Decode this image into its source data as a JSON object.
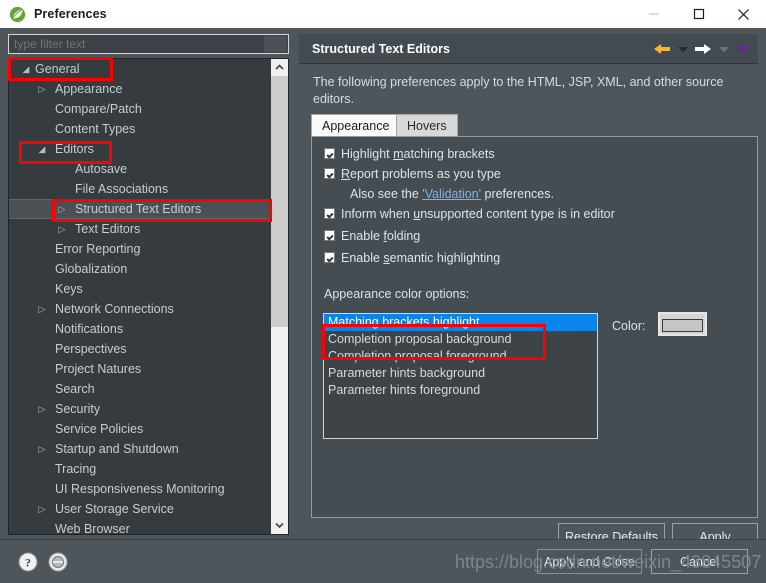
{
  "window": {
    "title": "Preferences",
    "icon": "spring-leaf-icon",
    "controls": {
      "minimize": "–",
      "maximize": "□",
      "close": "✕"
    }
  },
  "sidebar": {
    "filter": {
      "placeholder": "type filter text",
      "value": ""
    },
    "items": [
      {
        "label": "General",
        "indent": 0,
        "twisty": "expanded",
        "selected": false
      },
      {
        "label": "Appearance",
        "indent": 1,
        "twisty": "collapsed",
        "selected": false
      },
      {
        "label": "Compare/Patch",
        "indent": 1,
        "twisty": "none",
        "selected": false
      },
      {
        "label": "Content Types",
        "indent": 1,
        "twisty": "none",
        "selected": false
      },
      {
        "label": "Editors",
        "indent": 1,
        "twisty": "expanded",
        "selected": false
      },
      {
        "label": "Autosave",
        "indent": 2,
        "twisty": "none",
        "selected": false
      },
      {
        "label": "File Associations",
        "indent": 2,
        "twisty": "none",
        "selected": false
      },
      {
        "label": "Structured Text Editors",
        "indent": 2,
        "twisty": "collapsed",
        "selected": true
      },
      {
        "label": "Text Editors",
        "indent": 2,
        "twisty": "collapsed",
        "selected": false
      },
      {
        "label": "Error Reporting",
        "indent": 1,
        "twisty": "none",
        "selected": false
      },
      {
        "label": "Globalization",
        "indent": 1,
        "twisty": "none",
        "selected": false
      },
      {
        "label": "Keys",
        "indent": 1,
        "twisty": "none",
        "selected": false
      },
      {
        "label": "Network Connections",
        "indent": 1,
        "twisty": "collapsed",
        "selected": false
      },
      {
        "label": "Notifications",
        "indent": 1,
        "twisty": "none",
        "selected": false
      },
      {
        "label": "Perspectives",
        "indent": 1,
        "twisty": "none",
        "selected": false
      },
      {
        "label": "Project Natures",
        "indent": 1,
        "twisty": "none",
        "selected": false
      },
      {
        "label": "Search",
        "indent": 1,
        "twisty": "none",
        "selected": false
      },
      {
        "label": "Security",
        "indent": 1,
        "twisty": "collapsed",
        "selected": false
      },
      {
        "label": "Service Policies",
        "indent": 1,
        "twisty": "none",
        "selected": false
      },
      {
        "label": "Startup and Shutdown",
        "indent": 1,
        "twisty": "collapsed",
        "selected": false
      },
      {
        "label": "Tracing",
        "indent": 1,
        "twisty": "none",
        "selected": false
      },
      {
        "label": "UI Responsiveness Monitoring",
        "indent": 1,
        "twisty": "none",
        "selected": false
      },
      {
        "label": "User Storage Service",
        "indent": 1,
        "twisty": "collapsed",
        "selected": false
      },
      {
        "label": "Web Browser",
        "indent": 1,
        "twisty": "none",
        "selected": false
      }
    ]
  },
  "panel": {
    "title": "Structured Text Editors",
    "nav": {
      "back_icon": "arrow-left-icon",
      "back_menu_icon": "chevron-down-icon",
      "forward_icon": "arrow-right-icon",
      "forward_menu_icon": "chevron-down-icon",
      "more_icon": "chevron-down-icon"
    },
    "description": "The following preferences apply to the HTML, JSP, XML, and other source editors.",
    "tabs": [
      {
        "label": "Appearance",
        "active": true
      },
      {
        "label": "Hovers",
        "active": false
      }
    ],
    "checkboxes": [
      {
        "pre": "Highlight ",
        "mnemonic": "m",
        "post": "atching brackets",
        "checked": true
      },
      {
        "pre": "",
        "mnemonic": "R",
        "post": "eport problems as you type",
        "checked": true
      },
      {
        "pre": "Inform when ",
        "mnemonic": "u",
        "post": "nsupported content type is in editor",
        "checked": true
      },
      {
        "pre": "Enable ",
        "mnemonic": "f",
        "post": "olding",
        "checked": true
      },
      {
        "pre": "Enable ",
        "mnemonic": "s",
        "post": "emantic highlighting",
        "checked": true
      }
    ],
    "validation_note": {
      "prefix": "Also see the ",
      "link": "'Validation'",
      "suffix": " preferences."
    },
    "color_options_label": "Appearance color options:",
    "color_list": [
      {
        "label": "Matching brackets highlight",
        "selected": true
      },
      {
        "label": "Completion proposal background",
        "selected": false
      },
      {
        "label": "Completion proposal foreground",
        "selected": false
      },
      {
        "label": "Parameter hints background",
        "selected": false
      },
      {
        "label": "Parameter hints foreground",
        "selected": false
      }
    ],
    "color_label": "Color:",
    "color_swatch": "#c6c6c6",
    "buttons": {
      "restore_pre": "Restore ",
      "restore_mnemonic": "D",
      "restore_post": "efaults",
      "apply_pre": "",
      "apply_mnemonic": "A",
      "apply_post": "pply"
    }
  },
  "footer": {
    "help_icon": "help-circle-icon",
    "secondary_icon": "circle-button-icon",
    "apply_and_close": "Apply and Close",
    "cancel": "Cancel",
    "watermark": "https://blog.csdn.net/weixin_43845507"
  }
}
